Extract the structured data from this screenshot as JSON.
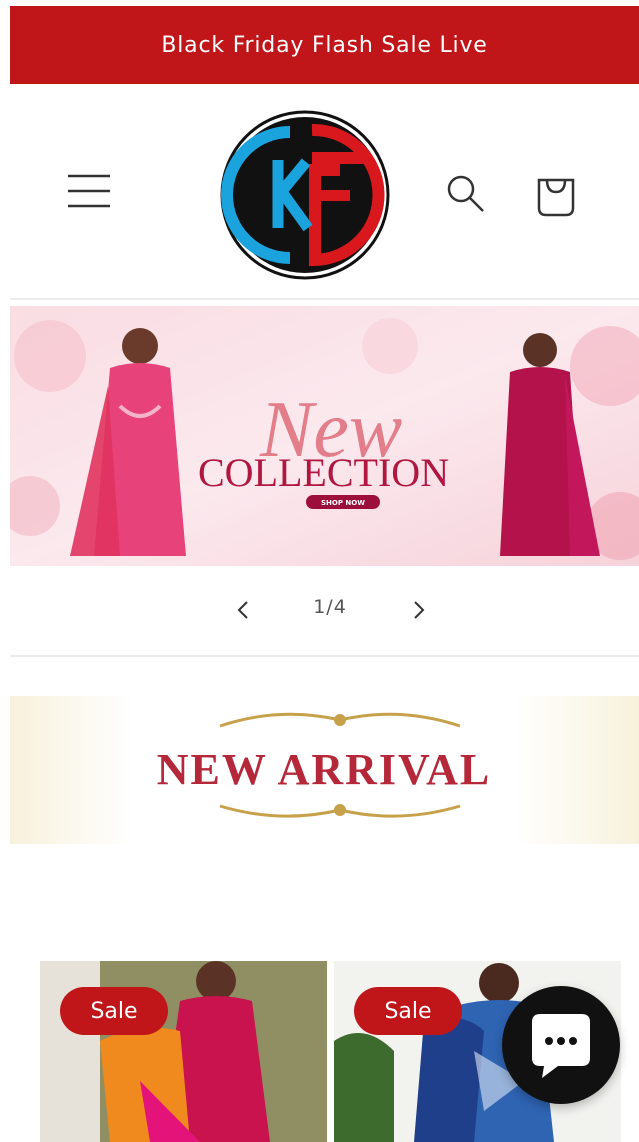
{
  "announcement": {
    "text": "Black Friday Flash Sale Live"
  },
  "header": {
    "menu_icon": "hamburger-menu-icon",
    "logo_text": "KF",
    "search_icon": "search-icon",
    "cart_icon": "cart-bag-icon"
  },
  "hero": {
    "script_text": "New",
    "headline": "COLLECTION",
    "cta": "SHOP NOW"
  },
  "slider": {
    "counter": "1/4",
    "prev_icon": "chevron-left-icon",
    "next_icon": "chevron-right-icon"
  },
  "section_banner": {
    "title": "NEW ARRIVAL"
  },
  "products": [
    {
      "badge": "Sale"
    },
    {
      "badge": "Sale"
    }
  ],
  "chat": {
    "icon": "chat-bubble-icon"
  },
  "colors": {
    "brand_red": "#c0161a",
    "logo_blue": "#1aa3dc",
    "chat_bg": "#111111"
  }
}
